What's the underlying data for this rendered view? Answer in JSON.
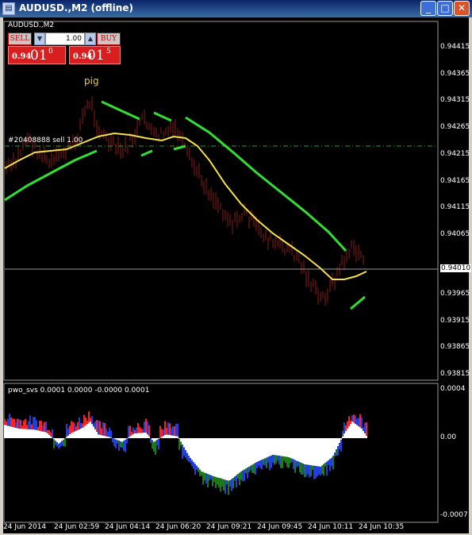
{
  "window": {
    "title": "AUDUSD.,M2 (offline)",
    "icon": "chart-window-icon",
    "buttons": {
      "minimize": "minimize-icon",
      "maximize": "maximize-icon",
      "close": "close-icon"
    }
  },
  "chart": {
    "symbol_label": "AUDUSD.,M2",
    "trade_panel": {
      "sell_label": "SELL",
      "buy_label": "BUY",
      "lot_value": "1.00",
      "sell_quote": {
        "prefix": "0.94",
        "big": "01",
        "sup": "0"
      },
      "buy_quote": {
        "prefix": "0.94",
        "big": "01",
        "sup": "5"
      }
    },
    "annotation_text": "pig",
    "order_line_label": "#20408888 sell 1.00",
    "price_axis": [
      "0.94415",
      "0.94365",
      "0.94315",
      "0.94265",
      "0.94215",
      "0.94165",
      "0.94115",
      "0.94065",
      "0.94010",
      "0.93965",
      "0.93915",
      "0.93865",
      "0.93815"
    ],
    "current_price": "0.94010",
    "oscillator": {
      "label": "pwo_svs 0.0001 0.0000 -0.0000 0.0001",
      "axis": [
        "0.0004",
        "0.00",
        "-0.0007"
      ]
    },
    "time_axis": [
      "24 Jun 2014",
      "24 Jun 02:59",
      "24 Jun 04:14",
      "24 Jun 06:20",
      "24 Jun 09:21",
      "24 Jun 09:45",
      "24 Jun 10:11",
      "24 Jun 10:35"
    ],
    "colors": {
      "background": "#000000",
      "candles": "#8b1a1a",
      "ma_yellow": "#f5e14a",
      "ma_green": "#33dd33",
      "histogram_red": "#ff2020",
      "histogram_blue": "#1f3fe0",
      "histogram_green": "#1a7a1a",
      "histogram_white": "#ffffff"
    }
  }
}
